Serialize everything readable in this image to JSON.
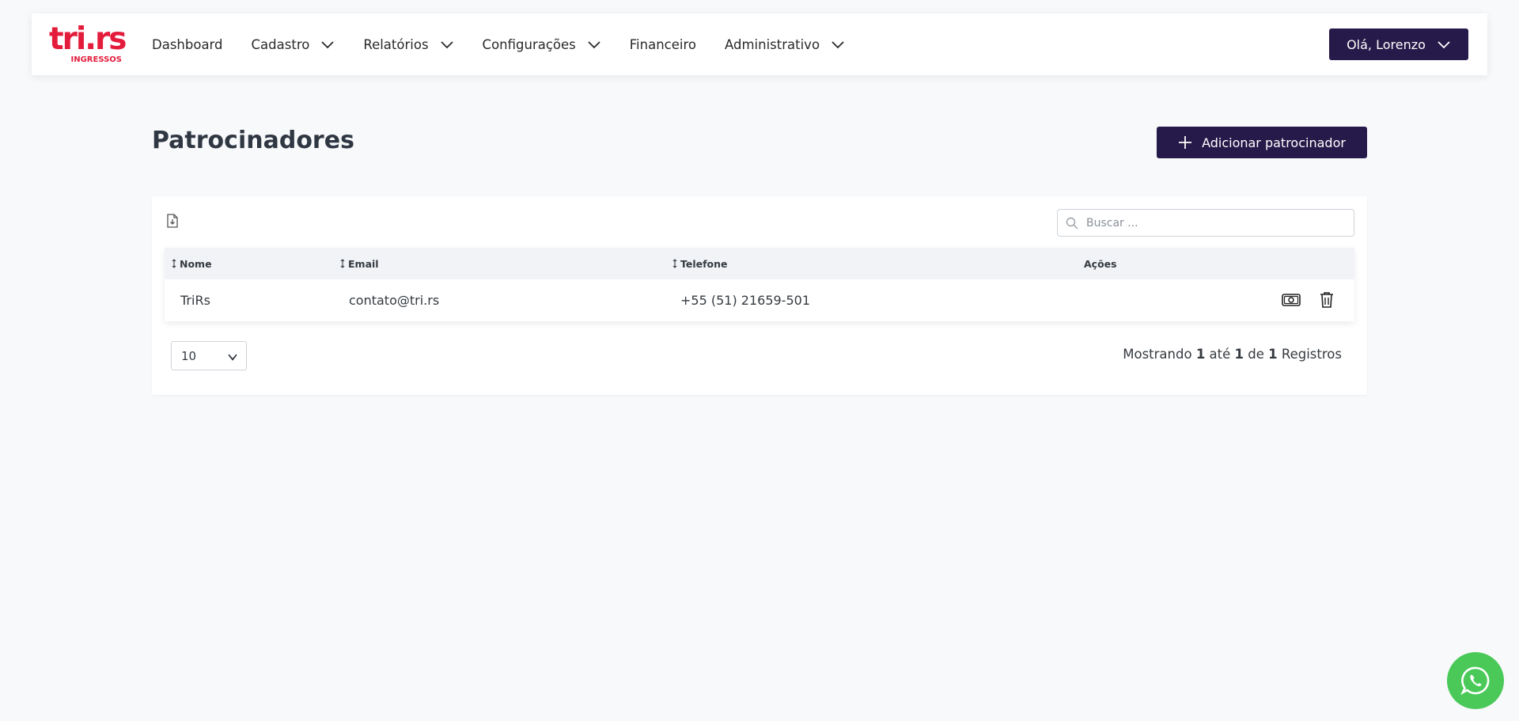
{
  "brand": {
    "logo_main": "tri.rs",
    "logo_sub": "INGRESSOS",
    "color": "#e41c3c"
  },
  "nav": {
    "items": [
      {
        "label": "Dashboard",
        "has_dropdown": false
      },
      {
        "label": "Cadastro",
        "has_dropdown": true
      },
      {
        "label": "Relatórios",
        "has_dropdown": true
      },
      {
        "label": "Configurações",
        "has_dropdown": true
      },
      {
        "label": "Financeiro",
        "has_dropdown": false
      },
      {
        "label": "Administrativo",
        "has_dropdown": true
      }
    ],
    "user_label": "Olá, Lorenzo"
  },
  "page": {
    "title": "Patrocinadores",
    "add_button_label": "Adicionar patrocinador"
  },
  "search": {
    "placeholder": "Buscar ..."
  },
  "table": {
    "headers": [
      "Nome",
      "Email",
      "Telefone",
      "Ações"
    ],
    "rows": [
      {
        "nome": "TriRs",
        "email": "contato@tri.rs",
        "telefone": "+55 (51) 21659-501"
      }
    ]
  },
  "pagination": {
    "page_size": "10",
    "info": {
      "prefix": "Mostrando",
      "from": "1",
      "to_word": "até",
      "to": "1",
      "of_word": "de",
      "total": "1",
      "suffix": "Registros"
    }
  },
  "colors": {
    "primary": "#261a4a",
    "accent": "#e41c3c",
    "whatsapp": "#4ac959"
  },
  "icons": [
    "chevron-down-icon",
    "plus-icon",
    "export-file-icon",
    "search-icon",
    "sort-icon",
    "money-icon",
    "trash-icon",
    "whatsapp-icon"
  ]
}
